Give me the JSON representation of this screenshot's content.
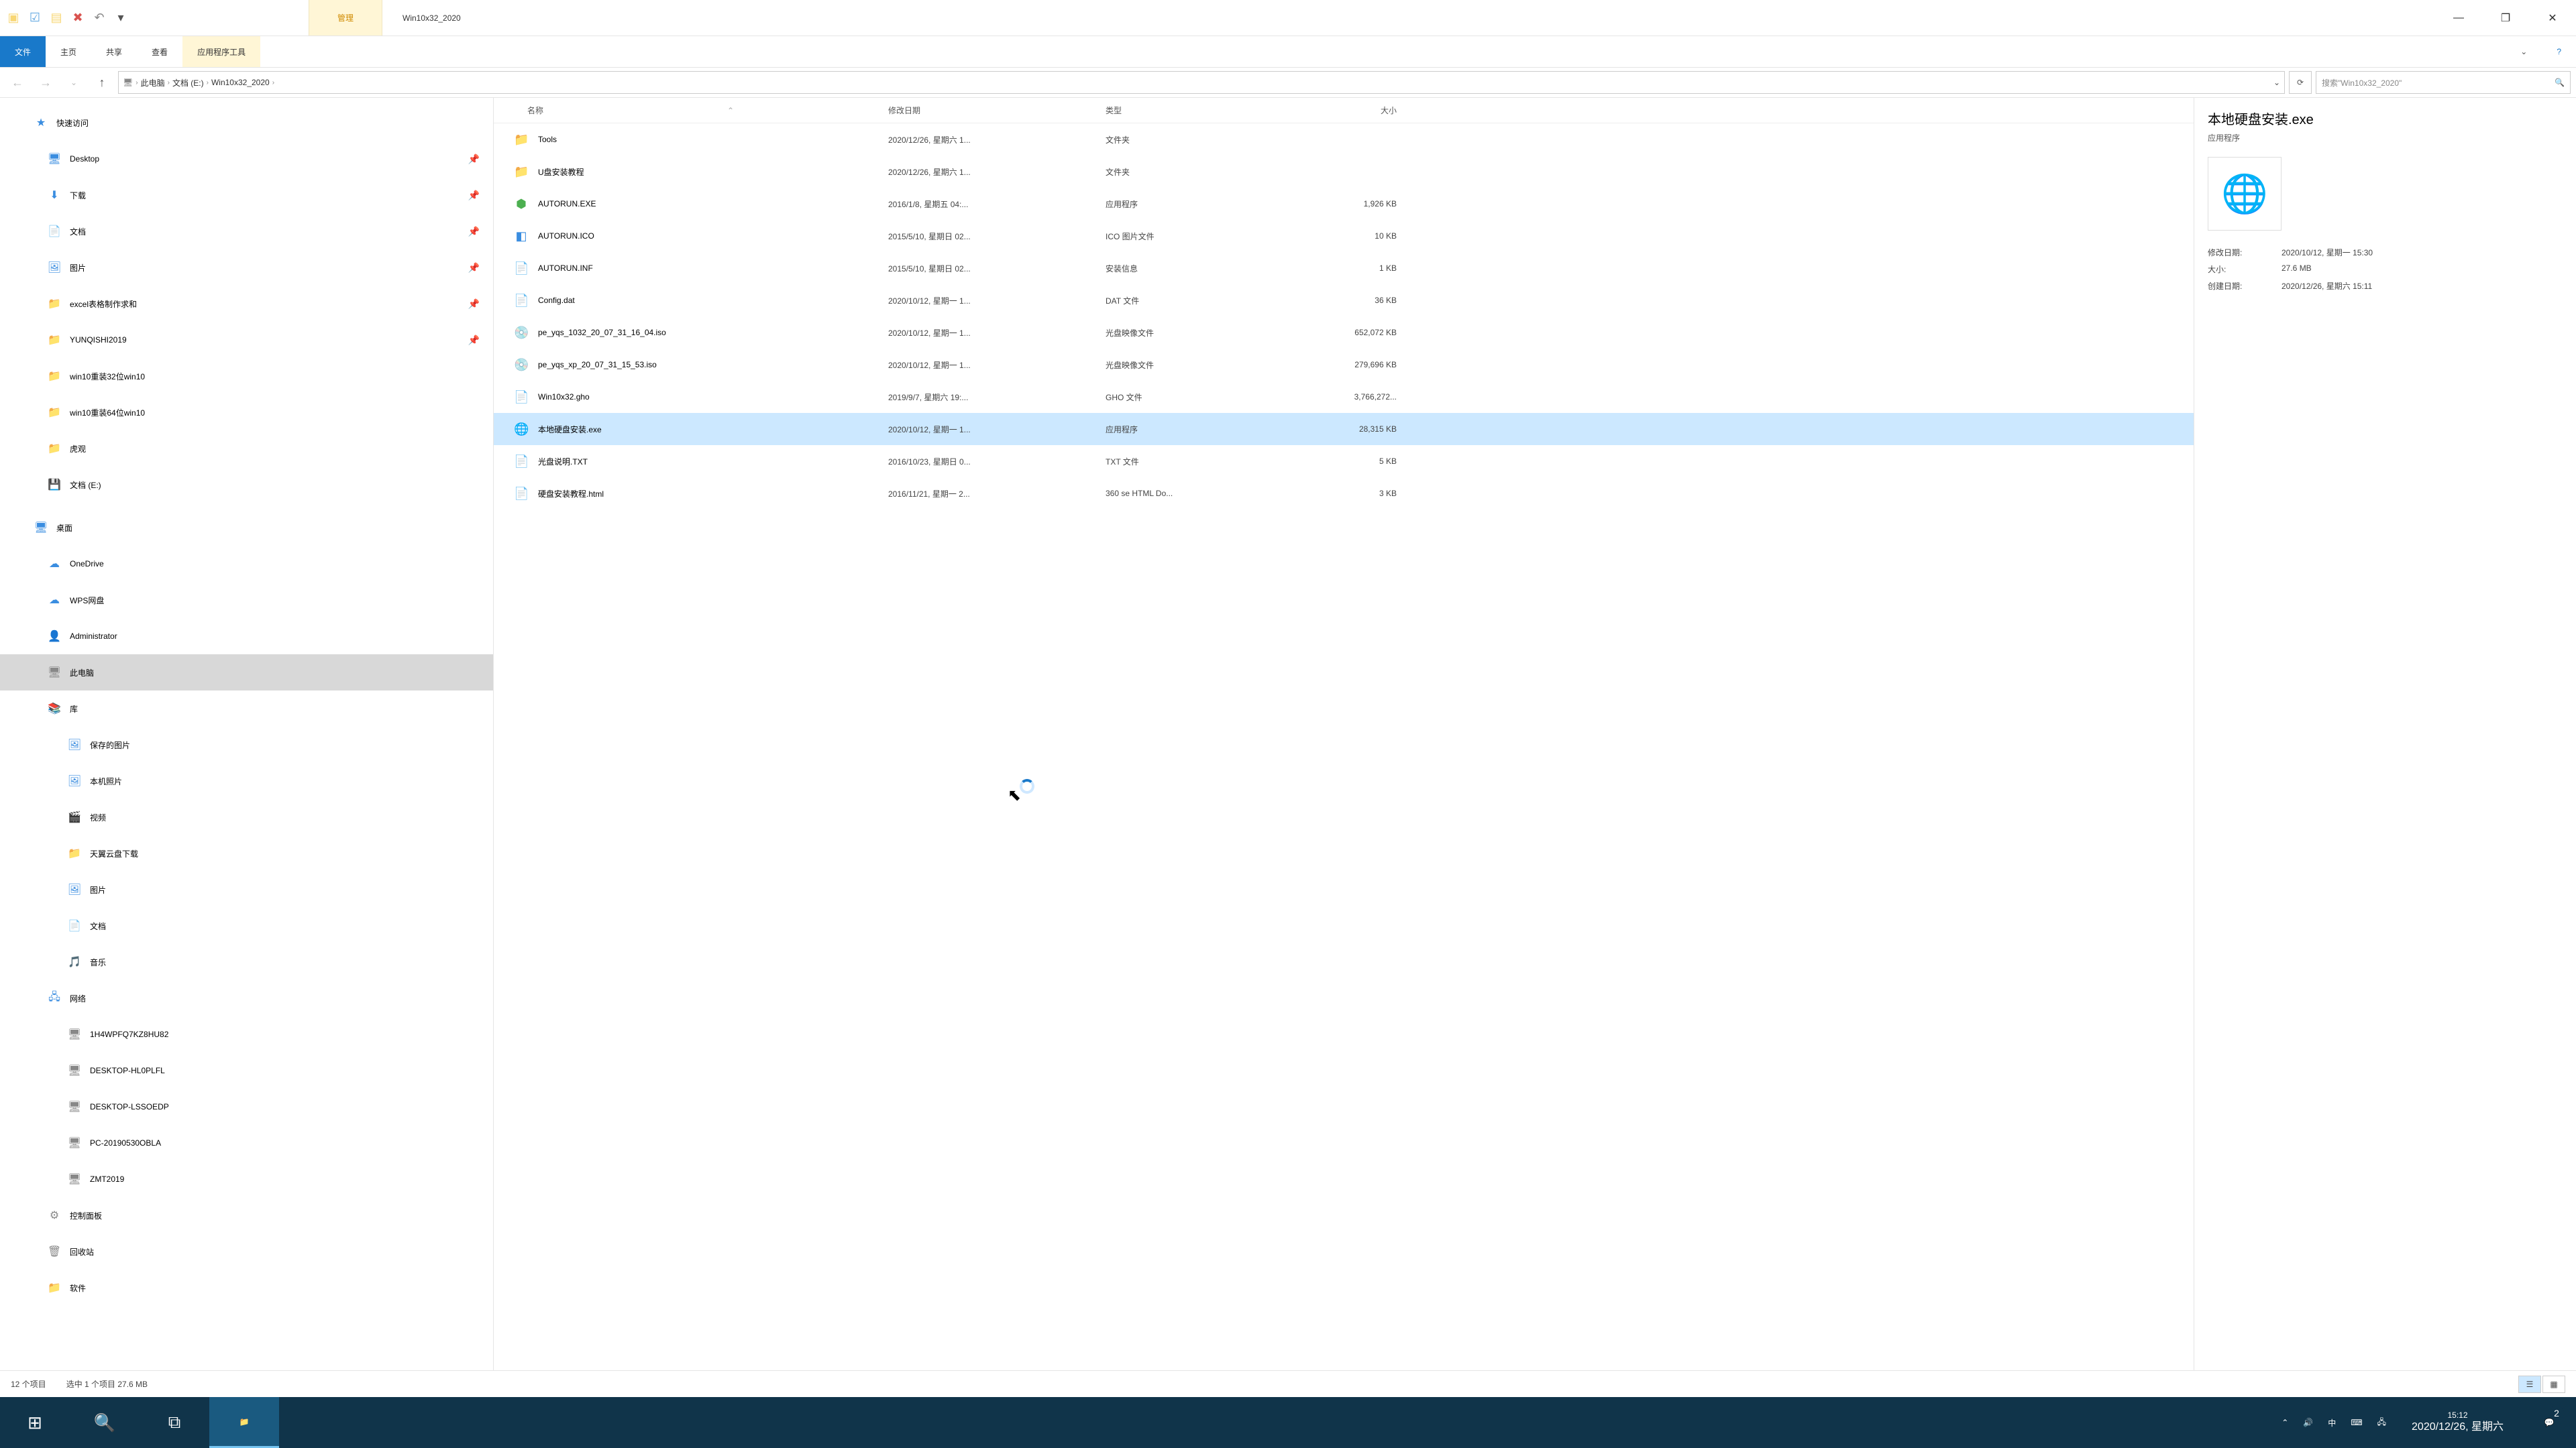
{
  "titlebar": {
    "manage": "管理",
    "title": "Win10x32_2020"
  },
  "ribbon": {
    "file": "文件",
    "home": "主页",
    "share": "共享",
    "view": "查看",
    "apptools": "应用程序工具"
  },
  "breadcrumb": {
    "pc": "此电脑",
    "drive": "文档 (E:)",
    "folder": "Win10x32_2020"
  },
  "search": {
    "placeholder": "搜索\"Win10x32_2020\""
  },
  "columns": {
    "name": "名称",
    "date": "修改日期",
    "type": "类型",
    "size": "大小"
  },
  "nav": {
    "quick": "快速访问",
    "desktop": "Desktop",
    "downloads": "下载",
    "documents": "文档",
    "pictures": "图片",
    "excel": "excel表格制作求和",
    "yunqishi": "YUNQISHI2019",
    "win32": "win10重装32位win10",
    "win64": "win10重装64位win10",
    "huguan": "虎观",
    "drive_e": "文档 (E:)",
    "desktop2": "桌面",
    "onedrive": "OneDrive",
    "wps": "WPS网盘",
    "admin": "Administrator",
    "thispc": "此电脑",
    "libraries": "库",
    "savedpics": "保存的图片",
    "localpics": "本机照片",
    "videos": "视频",
    "tianyi": "天翼云盘下载",
    "pictures2": "图片",
    "documents2": "文档",
    "music": "音乐",
    "network": "网络",
    "pc1": "1H4WPFQ7KZ8HU82",
    "pc2": "DESKTOP-HL0PLFL",
    "pc3": "DESKTOP-LSSOEDP",
    "pc4": "PC-20190530OBLA",
    "pc5": "ZMT2019",
    "control": "控制面板",
    "recycle": "回收站",
    "software": "软件"
  },
  "files": [
    {
      "name": "Tools",
      "date": "2020/12/26, 星期六 1...",
      "type": "文件夹",
      "size": "",
      "icon": "📁",
      "iconcls": "folder-ic"
    },
    {
      "name": "U盘安装教程",
      "date": "2020/12/26, 星期六 1...",
      "type": "文件夹",
      "size": "",
      "icon": "📁",
      "iconcls": "folder-ic"
    },
    {
      "name": "AUTORUN.EXE",
      "date": "2016/1/8, 星期五 04:...",
      "type": "应用程序",
      "size": "1,926 KB",
      "icon": "⬢",
      "iconcls": "green-ic"
    },
    {
      "name": "AUTORUN.ICO",
      "date": "2015/5/10, 星期日 02...",
      "type": "ICO 图片文件",
      "size": "10 KB",
      "icon": "◧",
      "iconcls": "blue-ic"
    },
    {
      "name": "AUTORUN.INF",
      "date": "2015/5/10, 星期日 02...",
      "type": "安装信息",
      "size": "1 KB",
      "icon": "📄",
      "iconcls": "gray-ic"
    },
    {
      "name": "Config.dat",
      "date": "2020/10/12, 星期一 1...",
      "type": "DAT 文件",
      "size": "36 KB",
      "icon": "📄",
      "iconcls": "gray-ic"
    },
    {
      "name": "pe_yqs_1032_20_07_31_16_04.iso",
      "date": "2020/10/12, 星期一 1...",
      "type": "光盘映像文件",
      "size": "652,072 KB",
      "icon": "💿",
      "iconcls": "gray-ic"
    },
    {
      "name": "pe_yqs_xp_20_07_31_15_53.iso",
      "date": "2020/10/12, 星期一 1...",
      "type": "光盘映像文件",
      "size": "279,696 KB",
      "icon": "💿",
      "iconcls": "gray-ic"
    },
    {
      "name": "Win10x32.gho",
      "date": "2019/9/7, 星期六 19:...",
      "type": "GHO 文件",
      "size": "3,766,272...",
      "icon": "📄",
      "iconcls": "gray-ic"
    },
    {
      "name": "本地硬盘安装.exe",
      "date": "2020/10/12, 星期一 1...",
      "type": "应用程序",
      "size": "28,315 KB",
      "icon": "🌐",
      "iconcls": "blue-ic",
      "sel": true
    },
    {
      "name": "光盘说明.TXT",
      "date": "2016/10/23, 星期日 0...",
      "type": "TXT 文件",
      "size": "5 KB",
      "icon": "📄",
      "iconcls": "green-ic"
    },
    {
      "name": "硬盘安装教程.html",
      "date": "2016/11/21, 星期一 2...",
      "type": "360 se HTML Do...",
      "size": "3 KB",
      "icon": "📄",
      "iconcls": "gray-ic"
    }
  ],
  "preview": {
    "title": "本地硬盘安装.exe",
    "subtitle": "应用程序",
    "mod_label": "修改日期:",
    "mod_val": "2020/10/12, 星期一 15:30",
    "size_label": "大小:",
    "size_val": "27.6 MB",
    "created_label": "创建日期:",
    "created_val": "2020/12/26, 星期六 15:11"
  },
  "status": {
    "count": "12 个项目",
    "selected": "选中 1 个项目  27.6 MB"
  },
  "tray": {
    "ime": "中",
    "time": "15:12",
    "date": "2020/12/26, 星期六",
    "notif_count": "2"
  }
}
